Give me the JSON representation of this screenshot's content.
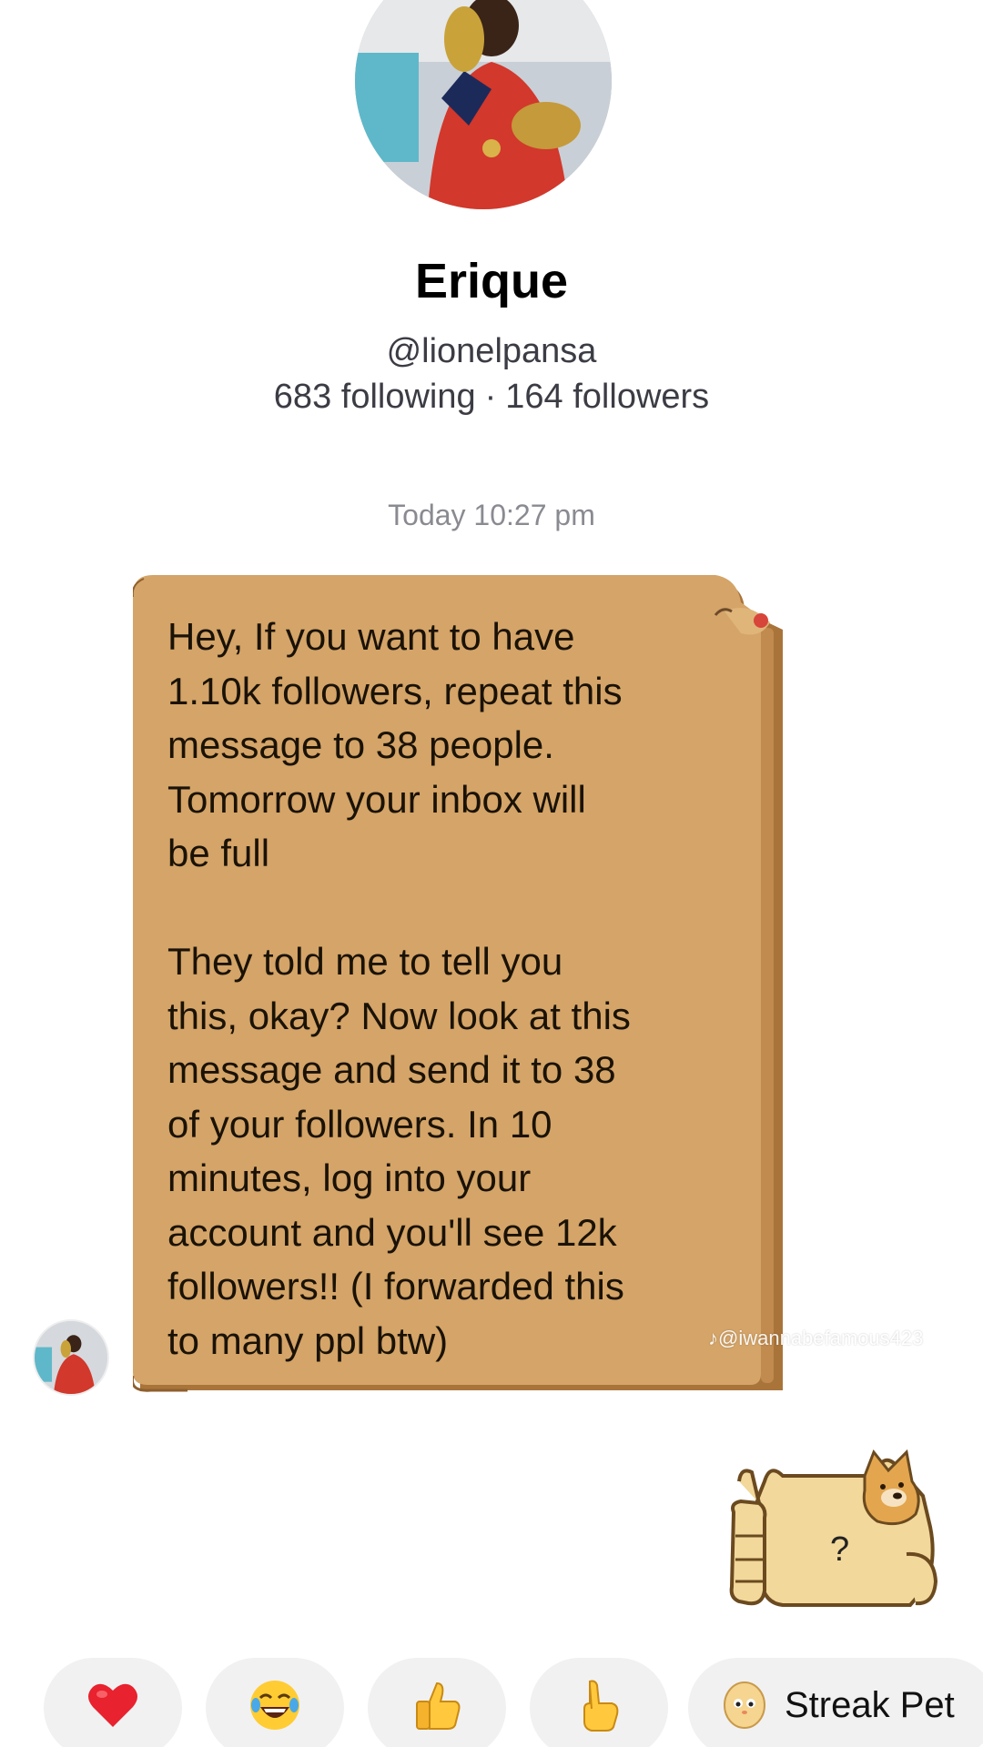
{
  "profile": {
    "name": "Erique",
    "handle": "@lionelpansa",
    "following": "683 following",
    "separator": "·",
    "followers": "164 followers"
  },
  "chat": {
    "timestamp": "Today 10:27 pm",
    "message": "Hey, If you want to have\n1.10k followers, repeat this\nmessage to 38 people.\nTomorrow your inbox will\nbe full\n\nThey told me to tell you\nthis, okay? Now look at this\nmessage and send it to 38\nof your followers. In 10\nminutes, log into your\naccount and you'll see 12k\nfollowers!! (I forwarded this\nto many ppl btw)",
    "watermark": "♪@iwannabefamous423",
    "sticker_text": "?",
    "bubble_color": "#d4a468",
    "bubble_edge": "#a9743a"
  },
  "quick_reactions": {
    "items": [
      "heart-icon",
      "laughing-face-icon",
      "thumbs-up-icon",
      "pointing-hand-icon"
    ],
    "streak_label": "Streak Pet"
  }
}
